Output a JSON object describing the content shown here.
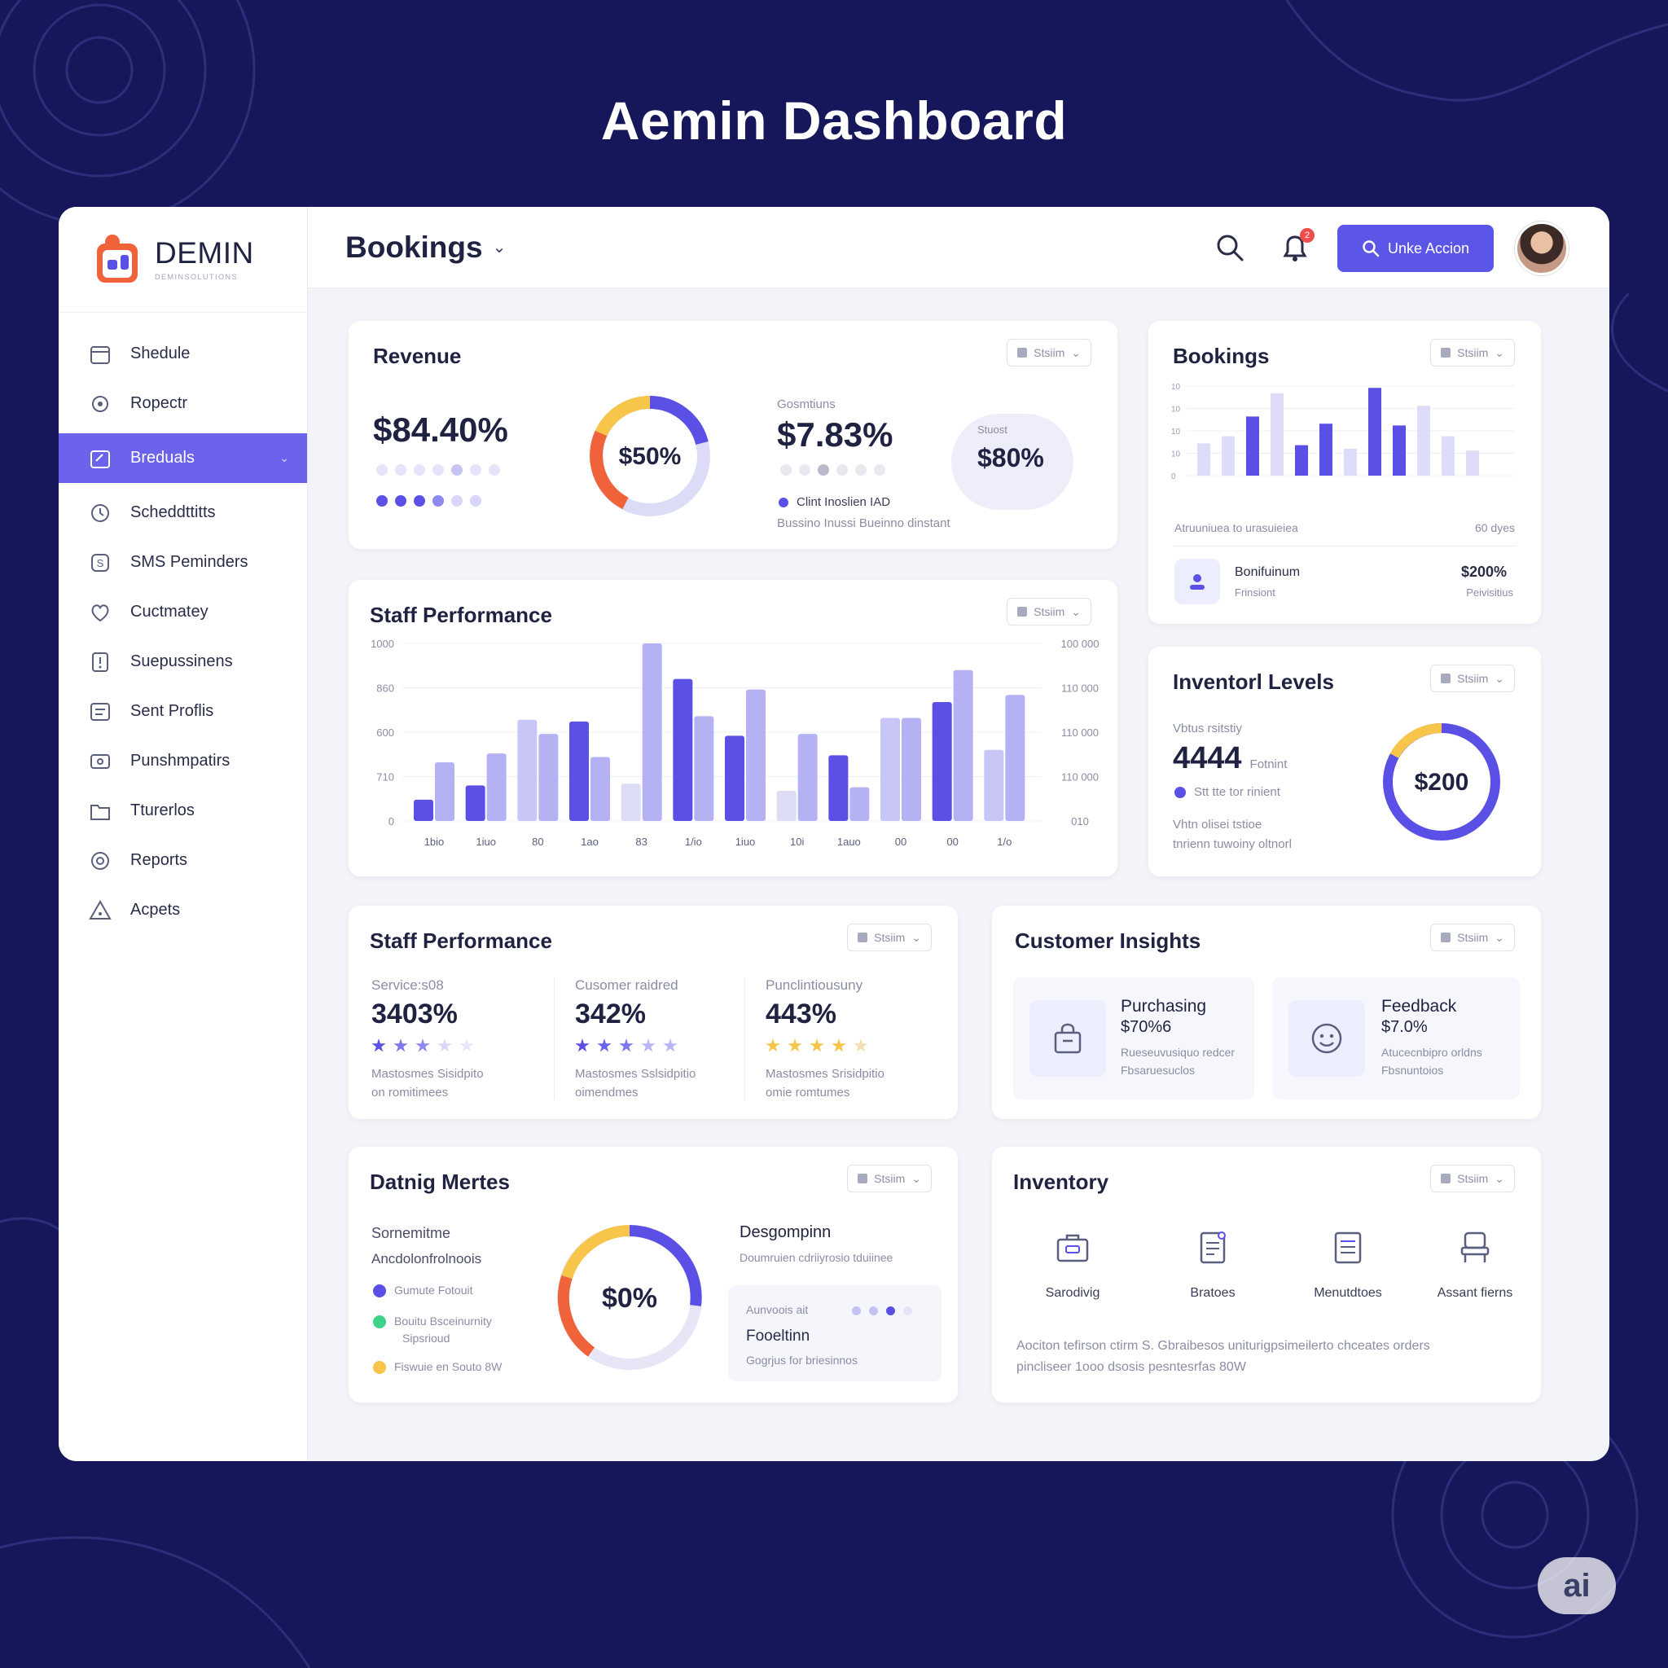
{
  "page_title": "Aemin Dashboard",
  "brand": {
    "name": "DEMIN",
    "sub": "DEMINSOLUTIONS"
  },
  "sidebar": {
    "items": [
      {
        "label": "Shedule",
        "icon": "calendar-icon"
      },
      {
        "label": "Ropectr",
        "icon": "gear-icon"
      },
      {
        "label": "Breduals",
        "icon": "calendar-edit-icon",
        "active": true
      },
      {
        "label": "Scheddttitts",
        "icon": "clock-icon"
      },
      {
        "label": "SMS Peminders",
        "icon": "sms-icon"
      },
      {
        "label": "Cuctmatey",
        "icon": "heart-icon"
      },
      {
        "label": "Suepussinens",
        "icon": "exclamation-icon"
      },
      {
        "label": "Sent Proflis",
        "icon": "profile-icon"
      },
      {
        "label": "Punshmpatirs",
        "icon": "card-icon"
      },
      {
        "label": "Tturerlos",
        "icon": "folder-icon"
      },
      {
        "label": "Reports",
        "icon": "target-icon"
      },
      {
        "label": "Acpets",
        "icon": "warning-icon"
      }
    ]
  },
  "topbar": {
    "title": "Bookings",
    "cta_label": "Unke Accion",
    "badge_count": "2",
    "search_icon": "search-icon",
    "bell_icon": "bell-icon"
  },
  "dropdown_label": "Stsiim",
  "dropdown_label_alt": "Stsiim",
  "revenue": {
    "title": "Revenue",
    "primary_value": "$84.40%",
    "donut_label": "$50%",
    "donut_fraction": 0.5,
    "secondary_caption": "Gosmtiuns",
    "secondary_value": "$7.83%",
    "legend": "Clint Inoslien IAD",
    "footnote": "Bussino Inussi Bueinno dinstant",
    "bubble_caption": "Stuost",
    "bubble_value": "$80%"
  },
  "bookings_card": {
    "title": "Bookings",
    "y_ticks": [
      "10",
      "10",
      "10",
      "10",
      "0"
    ],
    "bars": [
      0.36,
      0.44,
      0.66,
      0.92,
      0.34,
      0.58,
      0.3,
      0.98,
      0.56,
      0.78,
      0.44,
      0.28
    ],
    "footer_left": "Atruuniuea to urasuieiea",
    "footer_right": "60 dyes",
    "row_label": "Bonifuinum",
    "row_sub": "Frinsiont",
    "row_value": "$200%",
    "row_value_sub": "Peivisitius",
    "colors": {
      "accent": "#5b50e6",
      "light": "#dddcf9"
    }
  },
  "staff_performance_chart": {
    "title": "Staff Performance",
    "y_ticks_left": [
      "1000",
      "860",
      "600",
      "710",
      "0"
    ],
    "y_ticks_right": [
      "100 000",
      "110 000",
      "110 000",
      "110 000",
      "010"
    ],
    "x_labels": [
      "1bio",
      "1iuo",
      "80",
      "1ao",
      "83",
      "1/io",
      "1iuo",
      "10i",
      "1auo",
      "00",
      "00",
      "1/o"
    ],
    "chart_data": {
      "type": "bar",
      "categories": [
        "1bio",
        "1iuo",
        "80",
        "1ao",
        "83",
        "1/io",
        "1iuo",
        "10i",
        "1auo",
        "00",
        "00",
        "1/o"
      ],
      "series": [
        {
          "values": [
            12,
            20,
            57,
            56,
            21,
            80,
            48,
            17,
            37,
            58,
            67,
            40
          ]
        },
        {
          "values": [
            33,
            38,
            49,
            36,
            100,
            59,
            74,
            49,
            19,
            58,
            85,
            71
          ]
        }
      ],
      "ylim": [
        0,
        1000
      ]
    }
  },
  "inventory_levels": {
    "title": "Inventorl Levels",
    "caption": "Vbtus rsitstiy",
    "value": "4444",
    "value_sub": "Fotnint",
    "legend": "Stt tte tor rinient",
    "foot1": "Vhtn olisei tstioe",
    "foot2": "tnrienn tuwoiny oltnorl",
    "donut_label": "$200",
    "donut_fraction": 0.85
  },
  "staff_kpis": {
    "title": "Staff Performance",
    "items": [
      {
        "label": "Service:s08",
        "value": "3403%",
        "stars": 4,
        "desc1": "Mastosmes Sisidpito",
        "desc2": "on romitimees"
      },
      {
        "label": "Cusomer raidred",
        "value": "342%",
        "stars": 4,
        "desc1": "Mastosmes Sslsidpitio",
        "desc2": "oimendmes"
      },
      {
        "label": "Punclintiousuny",
        "value": "443%",
        "stars": 4,
        "desc1": "Mastosmes Srisidpitio",
        "desc2": "omie romtumes"
      }
    ]
  },
  "customer_insights": {
    "title": "Customer Insights",
    "items": [
      {
        "title": "Purchasing",
        "value": "$70%6",
        "desc1": "Rueseuvusiquo redcer",
        "desc2": "Fbsaruesuclos",
        "icon": "shopping-bag-icon"
      },
      {
        "title": "Feedback",
        "value": "$7.0%",
        "desc1": "Atucecnbipro orldns",
        "desc2": "Fbsnuntoios",
        "icon": "smiley-icon"
      }
    ]
  },
  "dating_metrics": {
    "title": "Datnig Mertes",
    "heading1": "Sornemitme",
    "heading2": "Ancdolonfrolnoois",
    "legend": [
      {
        "label": "Gumute Fotouit",
        "color": "#5b50e6"
      },
      {
        "label": "Bouitu Bsceinurnity",
        "label2": "Sipsrioud",
        "color": "#3ed38a"
      },
      {
        "label": "Fiswuie en Souto 8W",
        "color": "#f6c54a"
      }
    ],
    "donut_label": "$0%",
    "donut_fraction": 0.3,
    "right_title": "Desgompinn",
    "right_sub": "Doumruien cdriiyrosio tduiinee",
    "panel_caption": "Aunvoois ait",
    "panel_title": "Fooeltinn",
    "panel_sub": "Gogrjus for briesinnos"
  },
  "inventory": {
    "title": "Inventory",
    "items": [
      {
        "label": "Sarodivig",
        "icon": "briefcase-icon"
      },
      {
        "label": "Bratoes",
        "icon": "document-icon"
      },
      {
        "label": "Menutdtoes",
        "icon": "list-icon"
      },
      {
        "label": "Assant fierns",
        "icon": "chair-icon"
      }
    ],
    "note1": "Aociton tefirson ctirm S. Gbraibesos uniturigpsimeilerto chceates orders",
    "note2": "pincliseer 1ooo dsosis pesntesrfas 80W"
  },
  "watermark": "ai",
  "colors": {
    "accent": "#5c56e8",
    "accent_light": "#c7c6f6",
    "orange": "#f0633a",
    "yellow": "#f6c54a",
    "green": "#3ed38a",
    "bg": "#16175a"
  }
}
